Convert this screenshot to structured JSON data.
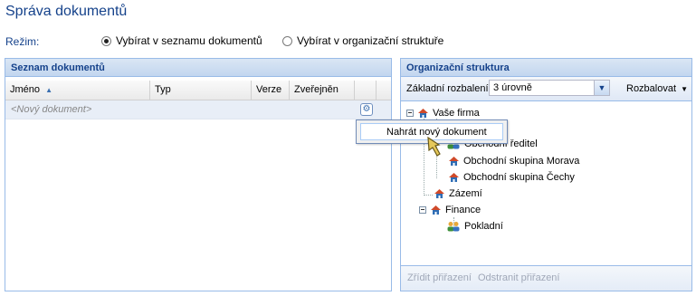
{
  "title": "Správa dokumentů",
  "mode": {
    "label": "Režim:",
    "options": [
      {
        "label": "Vybírat v seznamu dokumentů",
        "selected": true
      },
      {
        "label": "Vybírat v organizační struktuře",
        "selected": false
      }
    ]
  },
  "documents_panel": {
    "title": "Seznam dokumentů",
    "columns": [
      "Jméno",
      "Typ",
      "Verze",
      "Zveřejněn"
    ],
    "sort_column": "Jméno",
    "sort_direction": "ascending",
    "new_row_placeholder": "<Nový dokument>",
    "context_menu": {
      "item": "Nahrát nový dokument"
    }
  },
  "org_panel": {
    "title": "Organizační struktura",
    "expand_label": "Základní rozbalení:",
    "expand_value": "3 úrovně",
    "expand_button": "Rozbalovat",
    "tree": [
      {
        "label": "Vaše firma",
        "icon": "building-icon",
        "expanded": true
      },
      {
        "label": "Obchodní ředitel",
        "icon": "people-icon"
      },
      {
        "label": "Obchodní skupina Morava",
        "icon": "building-icon"
      },
      {
        "label": "Obchodní skupina Čechy",
        "icon": "building-icon"
      },
      {
        "label": "Zázemí",
        "icon": "building-icon"
      },
      {
        "label": "Finance",
        "icon": "building-icon",
        "expanded": true
      },
      {
        "label": "Pokladní",
        "icon": "people-icon"
      }
    ],
    "footer": {
      "create_label": "Zřídit přiřazení",
      "remove_label": "Odstranit přiřazení"
    }
  },
  "colors": {
    "accent": "#15428b",
    "border": "#99bbe8",
    "selection": "#e8eef7"
  }
}
